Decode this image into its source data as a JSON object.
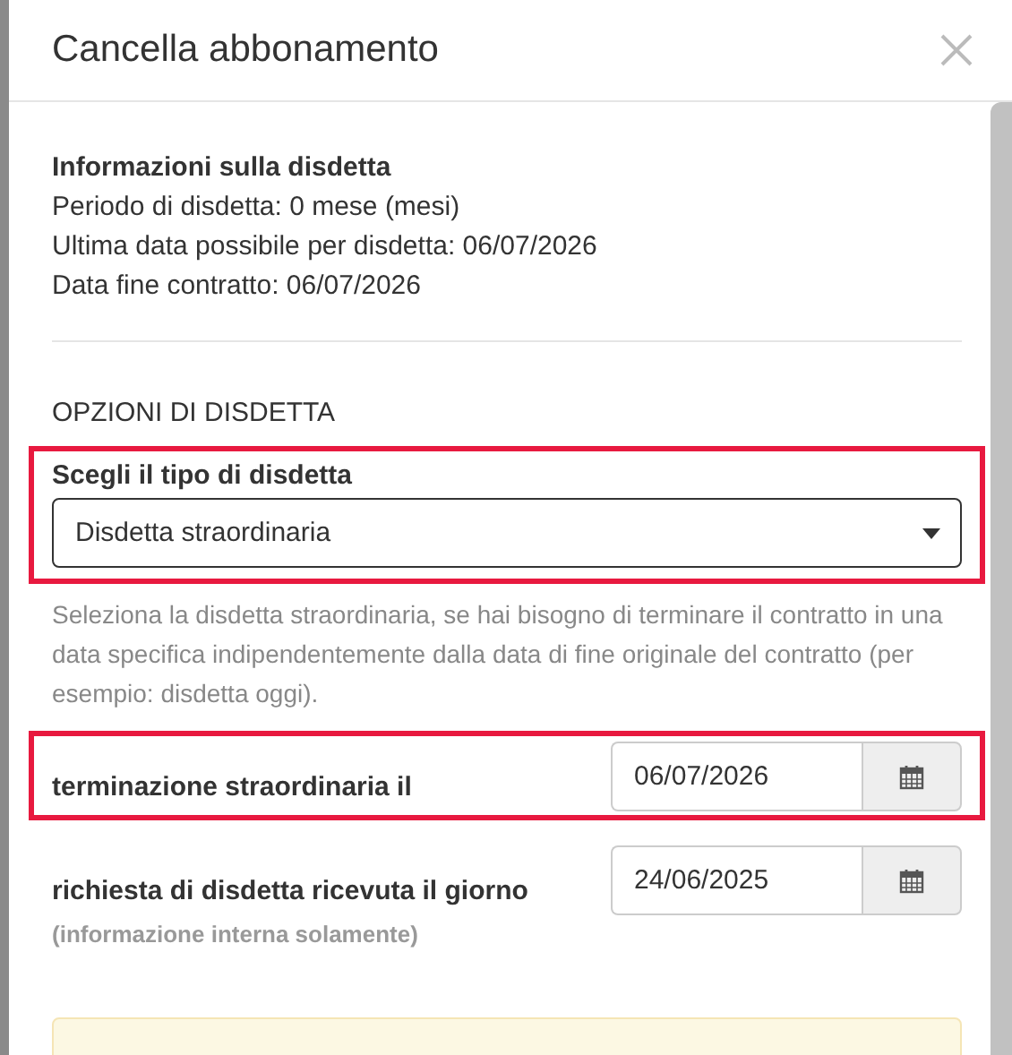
{
  "dialog": {
    "title": "Cancella abbonamento"
  },
  "info": {
    "heading": "Informazioni sulla disdetta",
    "lines": [
      "Periodo di disdetta: 0 mese (mesi)",
      "Ultima data possibile per disdetta: 06/07/2026",
      "Data fine contratto: 06/07/2026"
    ]
  },
  "section_heading": "OPZIONI DI DISDETTA",
  "type_select": {
    "label": "Scegli il tipo di disdetta",
    "value": "Disdetta straordinaria",
    "highlighted": true
  },
  "hint": "Seleziona la disdetta straordinaria, se hai bisogno di terminare il contratto in una data specifica indipendentemente dalla data di fine originale del contratto (per esempio: disdetta oggi).",
  "date_fields": [
    {
      "label": "terminazione straordinaria il",
      "value": "06/07/2026",
      "highlighted": true
    },
    {
      "label": "richiesta di disdetta ricevuta il giorno",
      "note": "(informazione interna solamente)",
      "value": "24/06/2025",
      "highlighted": false
    }
  ]
}
